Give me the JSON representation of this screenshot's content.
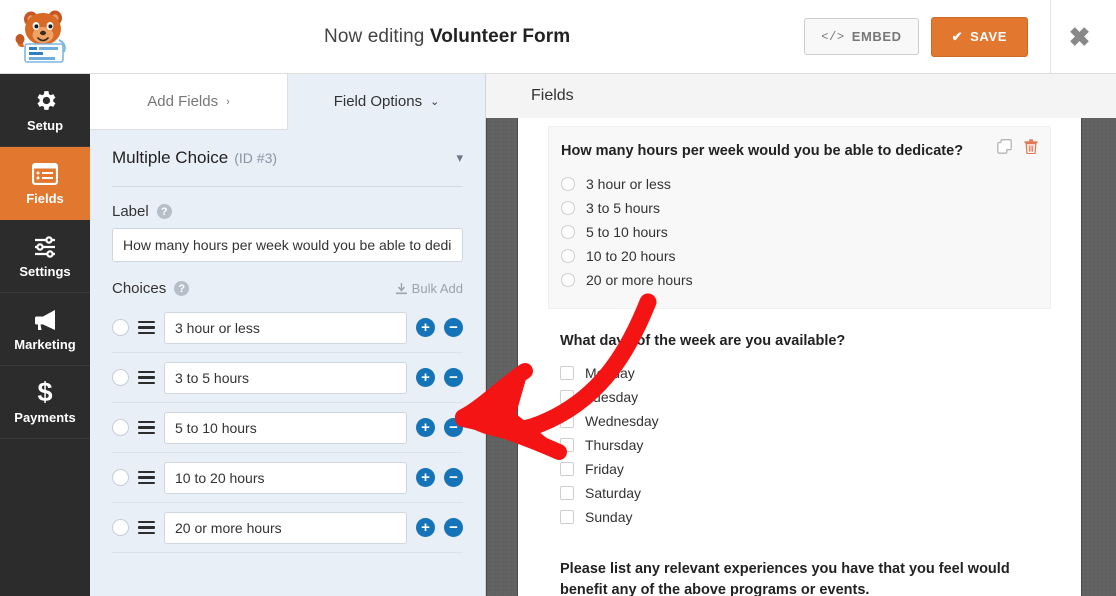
{
  "header": {
    "logo_icon": "wpforms-bear-logo",
    "title_prefix": "Now editing",
    "form_name": "Volunteer Form",
    "embed_label": "EMBED",
    "embed_icon": "code-icon",
    "save_label": "SAVE",
    "save_icon": "check-icon",
    "close_icon": "close-icon",
    "accent_color": "#e27730"
  },
  "sidebar": {
    "items": [
      {
        "label": "Setup",
        "icon": "gear-icon",
        "active": false
      },
      {
        "label": "Fields",
        "icon": "list-icon",
        "active": true
      },
      {
        "label": "Settings",
        "icon": "sliders-icon",
        "active": false
      },
      {
        "label": "Marketing",
        "icon": "megaphone-icon",
        "active": false
      },
      {
        "label": "Payments",
        "icon": "dollar-icon",
        "active": false
      }
    ]
  },
  "panel": {
    "tabs": [
      {
        "label": "Add Fields",
        "chevron": "›",
        "active": false
      },
      {
        "label": "Field Options",
        "chevron": "⌄",
        "active": true
      }
    ],
    "field_type": "Multiple Choice",
    "field_id": "(ID #3)",
    "collapse_icon": "chevron-down-icon",
    "label_section": {
      "title": "Label",
      "help_icon": "help-icon",
      "value": "How many hours per week would you be able to dedi"
    },
    "choices_section": {
      "title": "Choices",
      "help_icon": "help-icon",
      "bulk_add_label": "Bulk Add",
      "bulk_add_icon": "bulk-add-icon",
      "items": [
        "3 hour or less",
        "3 to 5 hours",
        "5 to 10 hours",
        "10 to 20 hours",
        "20 or more hours"
      ],
      "add_icon": "plus-icon",
      "remove_icon": "minus-icon",
      "drag_icon": "drag-handle-icon",
      "button_color": "#1574b8"
    }
  },
  "preview": {
    "header_title": "Fields",
    "fields": [
      {
        "type": "radio",
        "active": true,
        "label": "How many hours per week would you be able to dedicate?",
        "duplicate_icon": "duplicate-icon",
        "delete_icon": "trash-icon",
        "options": [
          "3 hour or less",
          "3 to 5 hours",
          "5 to 10 hours",
          "10 to 20 hours",
          "20 or more hours"
        ]
      },
      {
        "type": "checkbox",
        "active": false,
        "label": "What days of the week are you available?",
        "options": [
          "Monday",
          "Tuesday",
          "Wednesday",
          "Thursday",
          "Friday",
          "Saturday",
          "Sunday"
        ]
      },
      {
        "type": "text",
        "active": false,
        "label": "Please list any relevant experiences you have that you feel would benefit any of the above programs or events.",
        "options": []
      }
    ]
  },
  "annotation": {
    "type": "red-arrow",
    "color": "#f41414",
    "points_to": "choice-remove-button"
  }
}
